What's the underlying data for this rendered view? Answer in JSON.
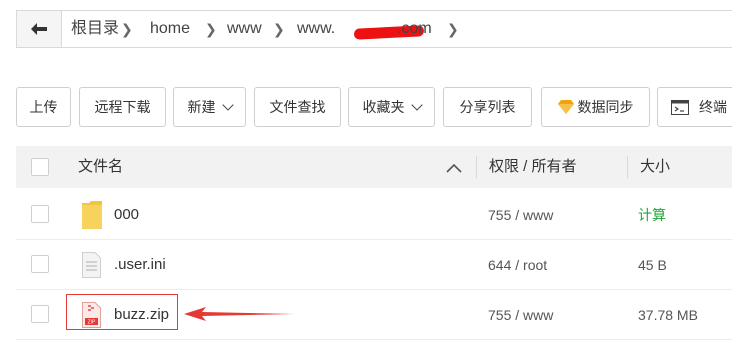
{
  "breadcrumb": {
    "back_icon": "arrow-left-icon",
    "items": [
      "根目录",
      "home",
      "www",
      "www.",
      ".com"
    ]
  },
  "toolbar": {
    "upload": "上传",
    "remote_download": "远程下载",
    "new": "新建",
    "file_search": "文件查找",
    "favorites": "收藏夹",
    "share_list": "分享列表",
    "data_sync": "数据同步",
    "terminal": "终端"
  },
  "table": {
    "headers": {
      "name": "文件名",
      "perm": "权限 / 所有者",
      "size": "大小"
    },
    "rows": [
      {
        "name": "000",
        "perm": "755 / www",
        "size": "计算",
        "icon": "folder-icon"
      },
      {
        "name": ".user.ini",
        "perm": "644 / root",
        "size": "45 B",
        "icon": "file-icon"
      },
      {
        "name": "buzz.zip",
        "perm": "755 / www",
        "size": "37.78 MB",
        "icon": "zip-file-icon"
      }
    ]
  },
  "colors": {
    "annotation_red": "#e53935",
    "size_calc_green": "#20a53a",
    "sync_gold": "#f0a30a"
  }
}
